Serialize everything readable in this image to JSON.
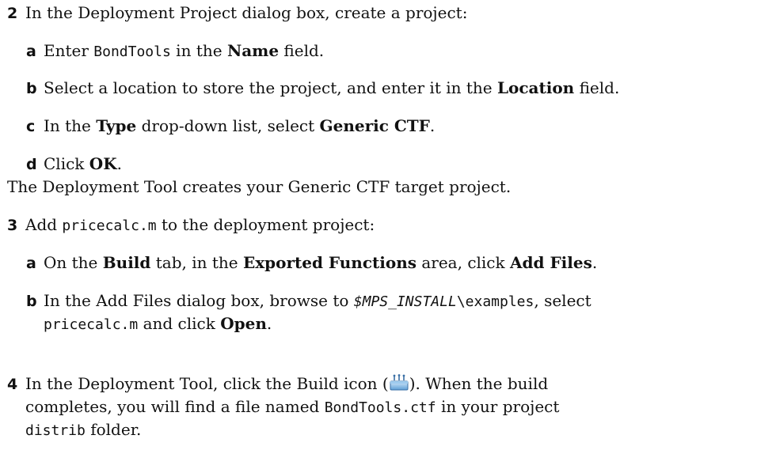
{
  "step2": {
    "number": "2",
    "text": "In the Deployment Project dialog box, create a project:",
    "a": {
      "letter": "a",
      "pre": "Enter ",
      "code": "BondTools",
      "mid": " in the ",
      "bold": "Name",
      "post": " field."
    },
    "b": {
      "letter": "b",
      "pre": "Select a location to store the project, and enter it in the ",
      "bold": "Location",
      "post": " field."
    },
    "c": {
      "letter": "c",
      "pre": "In the ",
      "bold1": "Type",
      "mid": " drop-down list, select ",
      "bold2": "Generic CTF",
      "post": "."
    },
    "d": {
      "letter": "d",
      "pre": "Click ",
      "bold": "OK",
      "post": "."
    },
    "note": "The Deployment Tool creates your Generic CTF target project."
  },
  "step3": {
    "number": "3",
    "pre": "Add ",
    "code": "pricecalc.m",
    "post": " to the deployment project:",
    "a": {
      "letter": "a",
      "pre": "On the ",
      "bold1": "Build",
      "mid1": " tab, in the ",
      "bold2": "Exported Functions",
      "mid2": " area, click ",
      "bold3": "Add Files",
      "post": "."
    },
    "b": {
      "letter": "b",
      "pre": "In the Add Files dialog box, browse to ",
      "code_italic": "$MPS_INSTALL",
      "code": "\\examples",
      "post": ", select",
      "line2_code": "pricecalc.m",
      "line2_mid": " and click ",
      "line2_bold": "Open",
      "line2_post": "."
    }
  },
  "step4": {
    "number": "4",
    "pre": "In the Deployment Tool, click the Build icon (",
    "icon": "build-icon",
    "post": ").  When the build",
    "line2_pre": "completes, you will find a file named ",
    "line2_code": "BondTools.ctf",
    "line2_post": " in your project",
    "line3_code": "distrib",
    "line3_post": " folder."
  }
}
